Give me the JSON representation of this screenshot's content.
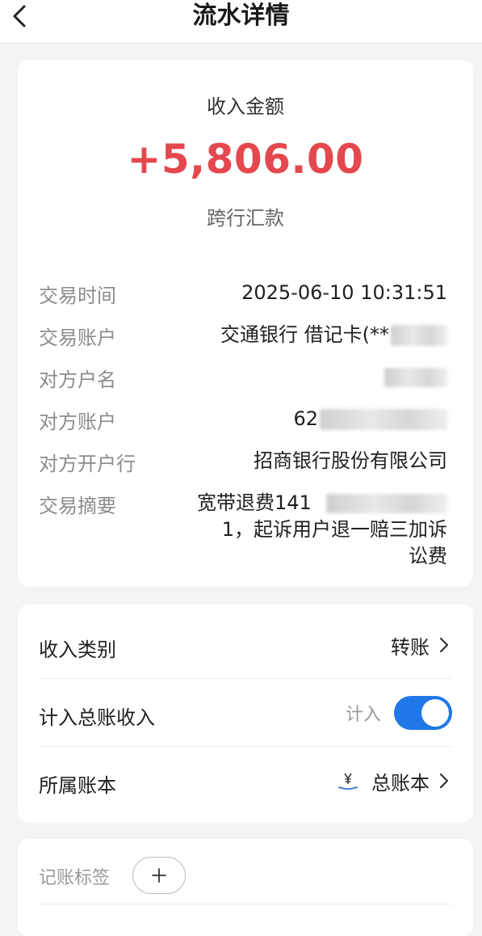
{
  "header": {
    "title": "流水详情"
  },
  "amount": {
    "label": "收入金额",
    "value": "+5,806.00",
    "type": "跨行汇款"
  },
  "details": {
    "time_label": "交易时间",
    "time_value": "2025-06-10 10:31:51",
    "account_label": "交易账户",
    "account_value": "交通银行 借记卡(**",
    "counterparty_name_label": "对方户名",
    "counterparty_account_label": "对方账户",
    "counterparty_account_value": "62",
    "counterparty_bank_label": "对方开户行",
    "counterparty_bank_value": "招商银行股份有限公司",
    "summary_label": "交易摘要",
    "summary_line1": "宽带退费141",
    "summary_line2": "1，起诉用户退一赔三加诉",
    "summary_line3": "讼费"
  },
  "settings": {
    "category_label": "收入类别",
    "category_value": "转账",
    "ledger_income_label": "计入总账收入",
    "ledger_income_switch_caption": "计入",
    "ledger_income_on": true,
    "book_label": "所属账本",
    "book_value": "总账本"
  },
  "tags": {
    "label": "记账标签",
    "add_symbol": "+"
  },
  "colors": {
    "amount": "#e4484e",
    "toggle": "#1f77e8",
    "background": "#f4f4f6"
  }
}
